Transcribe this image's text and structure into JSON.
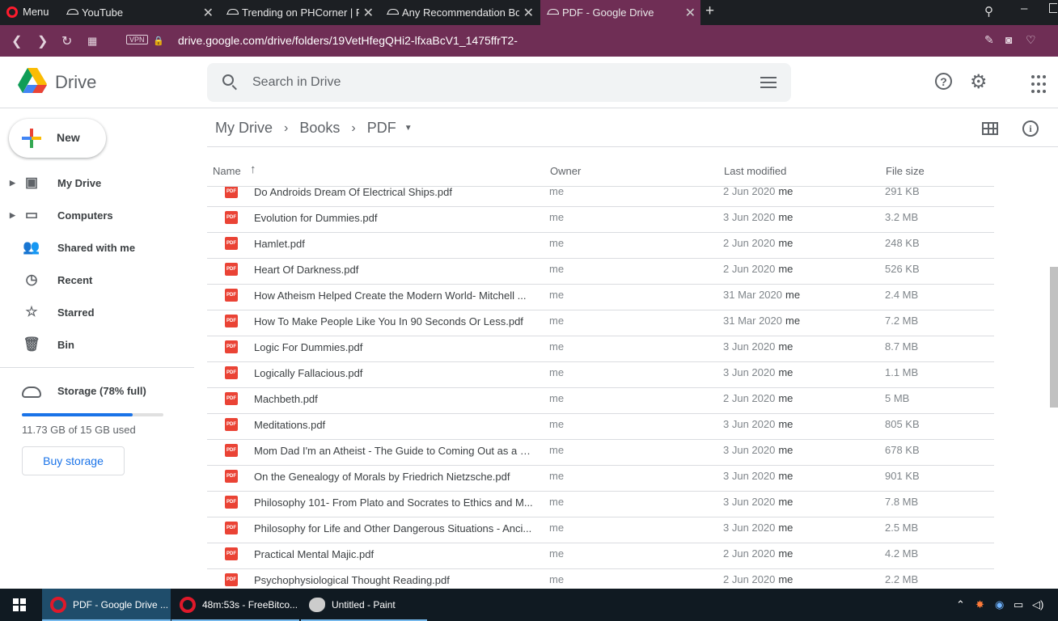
{
  "browser": {
    "menu_label": "Menu",
    "tabs": [
      {
        "title": "YouTube"
      },
      {
        "title": "Trending on PHCorner | Pin"
      },
      {
        "title": "Any Recommendation Book"
      },
      {
        "title": "PDF - Google Drive"
      }
    ],
    "vpn_badge": "VPN",
    "url": "drive.google.com/drive/folders/19VetHfegQHi2-lfxaBcV1_1475ffrT2-"
  },
  "header": {
    "product_name": "Drive",
    "search_placeholder": "Search in Drive"
  },
  "sidebar": {
    "new_label": "New",
    "items": [
      {
        "label": "My Drive",
        "icon": "my-drive-icon"
      },
      {
        "label": "Computers",
        "icon": "computers-icon"
      },
      {
        "label": "Shared with me",
        "icon": "shared-icon"
      },
      {
        "label": "Recent",
        "icon": "clock-icon"
      },
      {
        "label": "Starred",
        "icon": "star-icon"
      },
      {
        "label": "Bin",
        "icon": "trash-icon"
      }
    ],
    "storage": {
      "label": "Storage (78% full)",
      "used_text": "11.73 GB of 15 GB used",
      "fraction": 0.78,
      "buy_label": "Buy storage"
    }
  },
  "breadcrumb": [
    "My Drive",
    "Books",
    "PDF"
  ],
  "table": {
    "headers": {
      "name": "Name",
      "owner": "Owner",
      "modified": "Last modified",
      "size": "File size"
    },
    "rows": [
      {
        "name": "Do Androids Dream Of Electrical Ships.pdf",
        "owner": "me",
        "date": "2 Jun 2020",
        "by": "me",
        "size": "291 KB"
      },
      {
        "name": "Evolution for Dummies.pdf",
        "owner": "me",
        "date": "3 Jun 2020",
        "by": "me",
        "size": "3.2 MB"
      },
      {
        "name": "Hamlet.pdf",
        "owner": "me",
        "date": "2 Jun 2020",
        "by": "me",
        "size": "248 KB"
      },
      {
        "name": "Heart Of Darkness.pdf",
        "owner": "me",
        "date": "2 Jun 2020",
        "by": "me",
        "size": "526 KB"
      },
      {
        "name": "How Atheism Helped Create the Modern World- Mitchell ...",
        "owner": "me",
        "date": "31 Mar 2020",
        "by": "me",
        "size": "2.4 MB"
      },
      {
        "name": "How To Make People Like You In 90 Seconds Or Less.pdf",
        "owner": "me",
        "date": "31 Mar 2020",
        "by": "me",
        "size": "7.2 MB"
      },
      {
        "name": "Logic For Dummies.pdf",
        "owner": "me",
        "date": "3 Jun 2020",
        "by": "me",
        "size": "8.7 MB"
      },
      {
        "name": "Logically Fallacious.pdf",
        "owner": "me",
        "date": "3 Jun 2020",
        "by": "me",
        "size": "1.1 MB"
      },
      {
        "name": "Machbeth.pdf",
        "owner": "me",
        "date": "2 Jun 2020",
        "by": "me",
        "size": "5 MB"
      },
      {
        "name": "Meditations.pdf",
        "owner": "me",
        "date": "3 Jun 2020",
        "by": "me",
        "size": "805 KB"
      },
      {
        "name": "Mom Dad I'm an Atheist - The Guide to Coming Out as a N...",
        "owner": "me",
        "date": "3 Jun 2020",
        "by": "me",
        "size": "678 KB"
      },
      {
        "name": "On the Genealogy of Morals by Friedrich Nietzsche.pdf",
        "owner": "me",
        "date": "3 Jun 2020",
        "by": "me",
        "size": "901 KB"
      },
      {
        "name": "Philosophy 101- From Plato and Socrates to Ethics and M...",
        "owner": "me",
        "date": "3 Jun 2020",
        "by": "me",
        "size": "7.8 MB"
      },
      {
        "name": "Philosophy for Life and Other Dangerous Situations - Anci...",
        "owner": "me",
        "date": "3 Jun 2020",
        "by": "me",
        "size": "2.5 MB"
      },
      {
        "name": "Practical Mental Majic.pdf",
        "owner": "me",
        "date": "2 Jun 2020",
        "by": "me",
        "size": "4.2 MB"
      },
      {
        "name": "Psychophysiological Thought Reading.pdf",
        "owner": "me",
        "date": "2 Jun 2020",
        "by": "me",
        "size": "2.2 MB"
      }
    ]
  },
  "taskbar": {
    "items": [
      {
        "label": "PDF - Google Drive ..."
      },
      {
        "label": "48m:53s - FreeBitco..."
      },
      {
        "label": "Untitled - Paint"
      }
    ]
  },
  "colors": {
    "accent": "#1a73e8",
    "browser_bar": "#6f2e55",
    "pdf_red": "#ea4335"
  }
}
